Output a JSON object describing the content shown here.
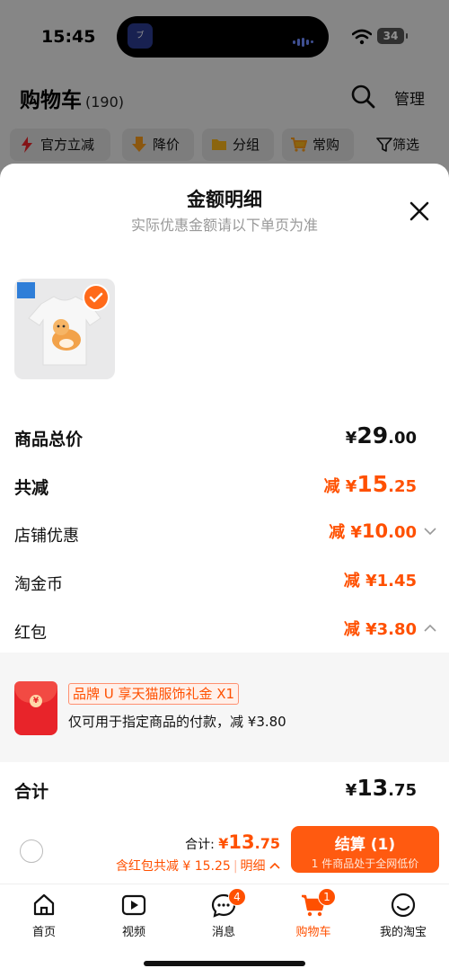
{
  "status_bar": {
    "time": "15:45",
    "battery": "34",
    "island_app": "ブ"
  },
  "page": {
    "title": "购物车",
    "count": "(190)",
    "manage": "管理"
  },
  "chips": [
    {
      "label": "官方立减",
      "icon": "lightning-icon"
    },
    {
      "label": "降价",
      "icon": "arrow-down-icon"
    },
    {
      "label": "分组",
      "icon": "folder-icon"
    },
    {
      "label": "常购",
      "icon": "cart-icon"
    },
    {
      "label": "筛选",
      "icon": "filter-icon"
    }
  ],
  "sheet": {
    "title": "金额明细",
    "subtitle": "实际优惠金额请以下单页为准",
    "rows": {
      "total": {
        "label": "商品总价",
        "prefix": "¥",
        "int": "29",
        "dec": ".00"
      },
      "discount": {
        "label": "共减",
        "prefix": "减 ¥",
        "int": "15",
        "dec": ".25"
      },
      "shop": {
        "label": "店铺优惠",
        "prefix": "减 ¥",
        "int": "10",
        "dec": ".00"
      },
      "coins": {
        "label": "淘金币",
        "value": "减 ¥1.45"
      },
      "redpacket": {
        "label": "红包",
        "value": "减 ¥3.80"
      },
      "sum": {
        "label": "合计",
        "prefix": "¥",
        "int": "13",
        "dec": ".75"
      }
    },
    "red_packet": {
      "tag": "品牌 U 享天猫服饰礼金 X1",
      "desc": "仅可用于指定商品的付款，减 ¥3.80"
    }
  },
  "checkout": {
    "total_label": "合计: ",
    "total_prefix": "¥",
    "total_int": "13",
    "total_dec": ".75",
    "savings": "含红包共减 ¥ 15.25",
    "details": "明细",
    "pay_label": "结算 (1)",
    "pay_sub": "1 件商品处于全网低价"
  },
  "tabbar": [
    {
      "label": "首页",
      "icon": "home-icon"
    },
    {
      "label": "视频",
      "icon": "video-icon"
    },
    {
      "label": "消息",
      "icon": "message-icon",
      "badge": "4"
    },
    {
      "label": "购物车",
      "icon": "cart-icon",
      "badge": "1",
      "active": true
    },
    {
      "label": "我的淘宝",
      "icon": "profile-icon"
    }
  ],
  "colors": {
    "accent": "#ff5000",
    "button": "#ff5a10",
    "red_packet": "#e8242a"
  }
}
